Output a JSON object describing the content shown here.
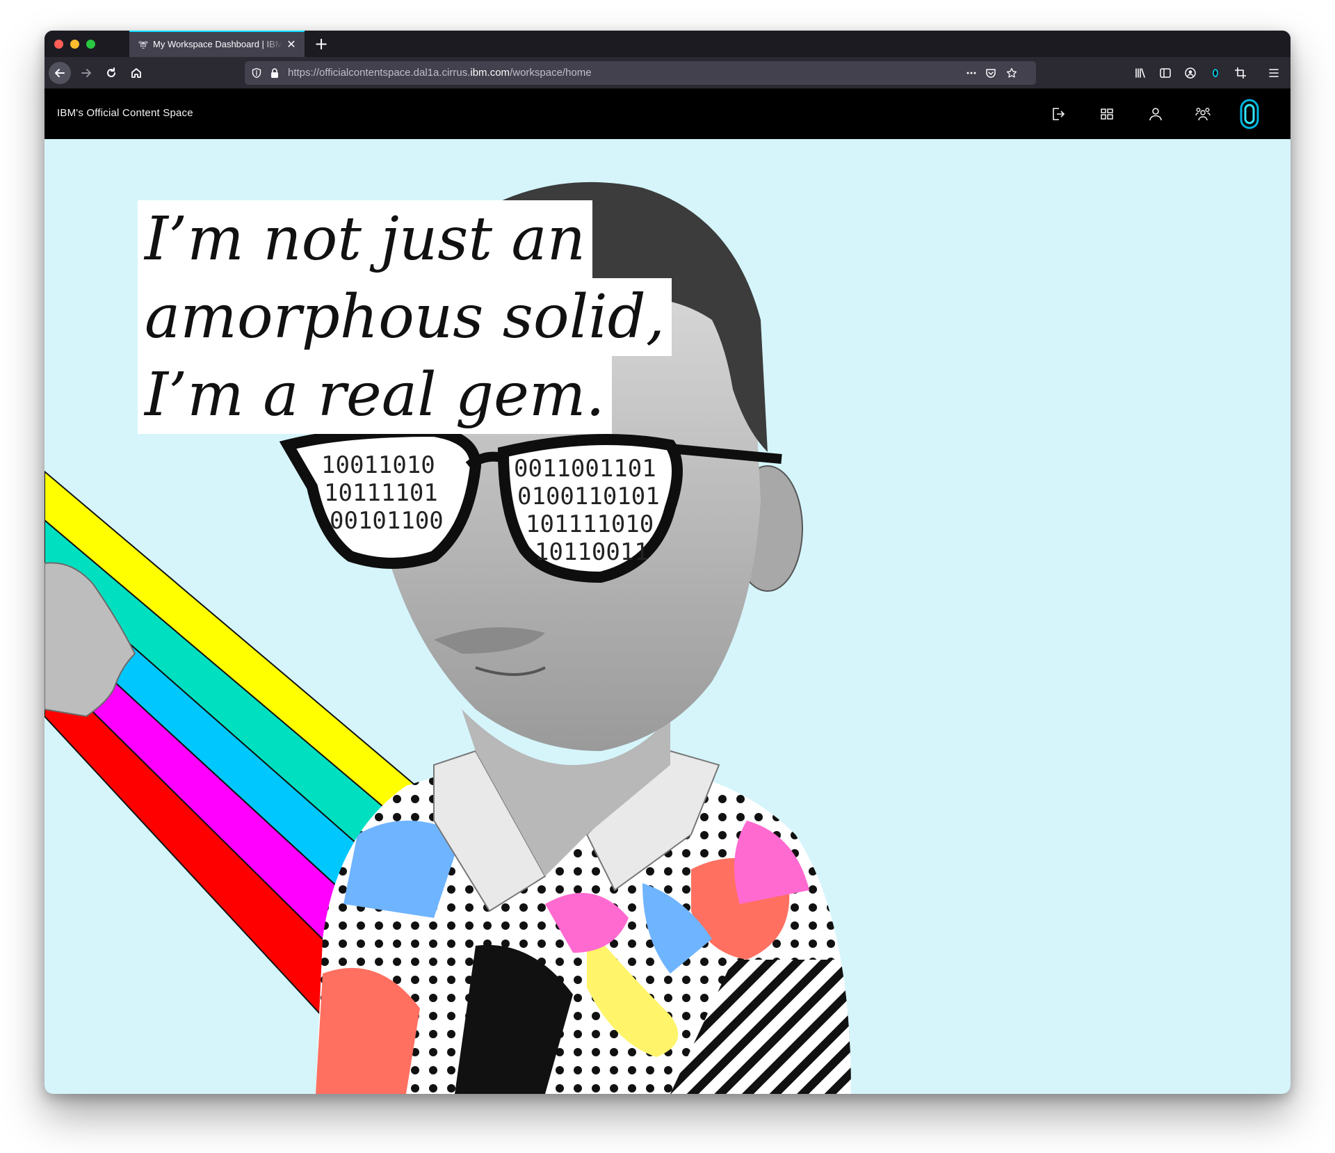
{
  "browser": {
    "tab_title": "My Workspace Dashboard | IBM",
    "url_prefix": "https://officialcontentspace.dal1a.cirrus.",
    "url_domain": "ibm.com",
    "url_path": "/workspace/home"
  },
  "app": {
    "title": "IBM's Official Content Space",
    "header_icons": [
      "logout-icon",
      "apps-grid-icon",
      "user-icon",
      "group-icon",
      "watson-assistant-icon"
    ]
  },
  "hero": {
    "quote_lines": [
      "I’m not just an",
      "amorphous solid,",
      "I’m a real gem."
    ]
  },
  "colors": {
    "hero_background": "#d5f5fb",
    "app_header": "#000000",
    "rainbow": [
      "#ffff00",
      "#00e0c0",
      "#00c8ff",
      "#ff00ff",
      "#ff0000"
    ],
    "accent": "#00ddff"
  }
}
